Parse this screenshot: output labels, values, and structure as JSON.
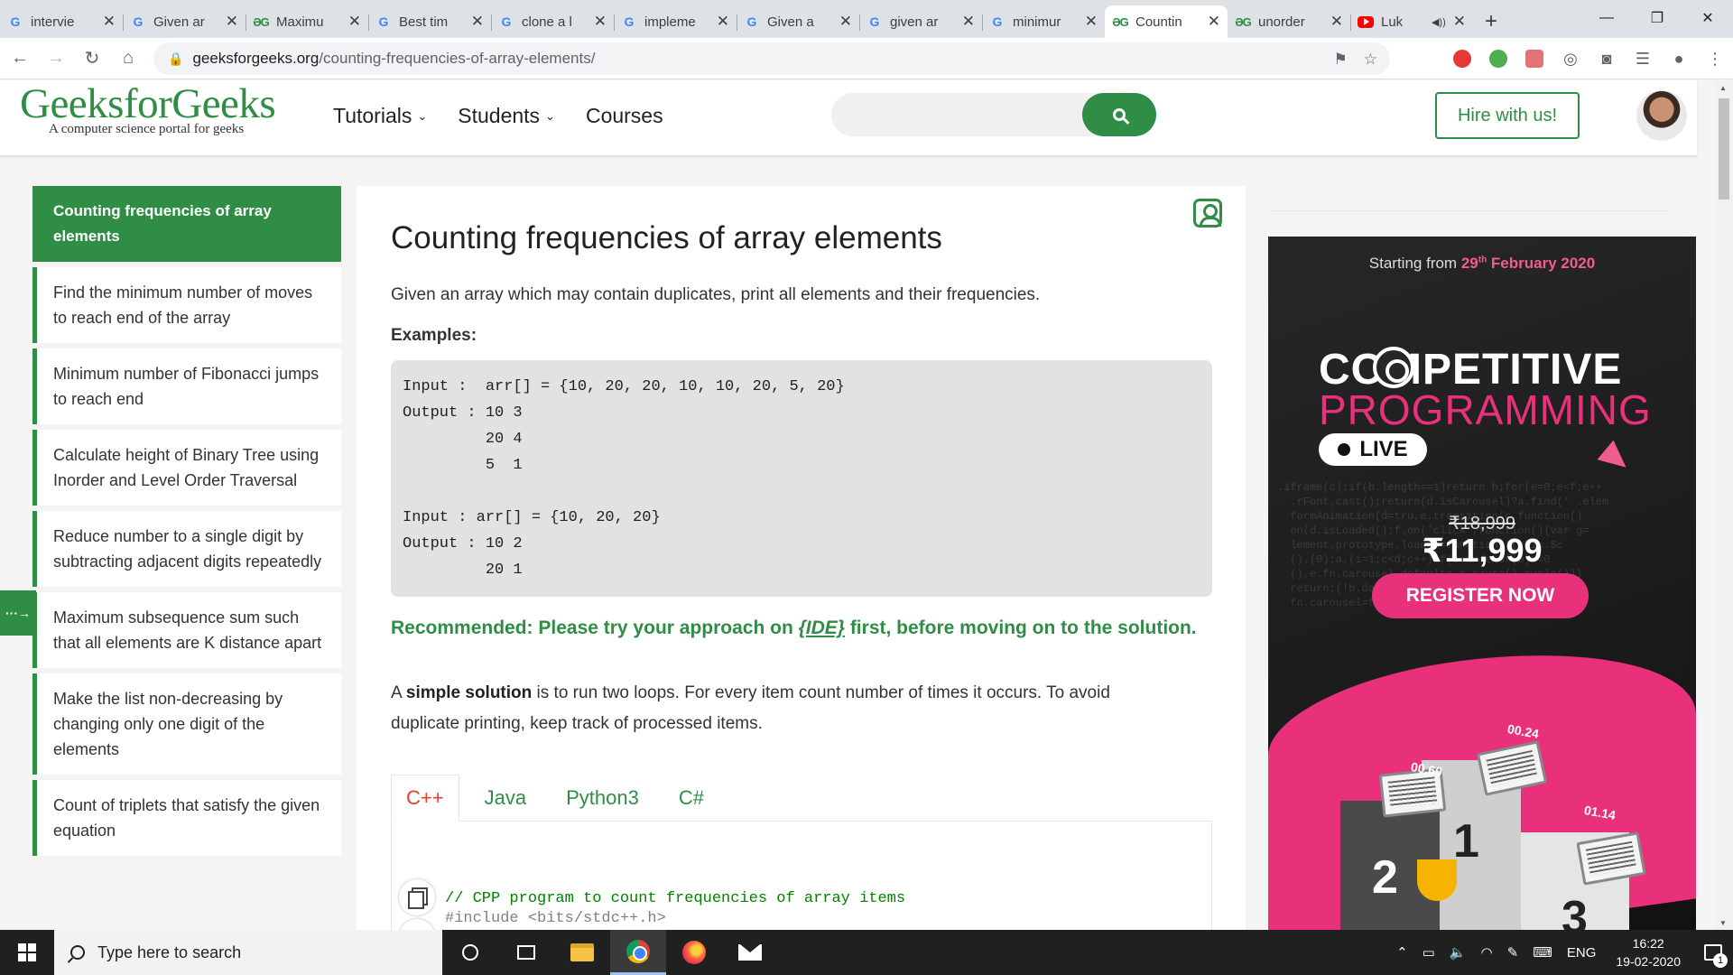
{
  "browser": {
    "tabs": [
      {
        "label": "intervie",
        "favicon": "google-icon"
      },
      {
        "label": "Given ar",
        "favicon": "google-icon"
      },
      {
        "label": "Maximu",
        "favicon": "gfg-icon"
      },
      {
        "label": "Best tim",
        "favicon": "google-icon"
      },
      {
        "label": "clone a l",
        "favicon": "google-icon"
      },
      {
        "label": "impleme",
        "favicon": "google-icon"
      },
      {
        "label": "Given a",
        "favicon": "google-icon"
      },
      {
        "label": "given ar",
        "favicon": "google-icon"
      },
      {
        "label": "minimur",
        "favicon": "google-icon"
      },
      {
        "label": "Countin",
        "favicon": "gfg-icon",
        "active": true
      },
      {
        "label": "unorder",
        "favicon": "gfg-icon"
      },
      {
        "label": "Luk",
        "favicon": "youtube-icon",
        "audio": true
      }
    ],
    "close_glyph": "✕",
    "url_domain": "geeksforgeeks.org",
    "url_path": "/counting-frequencies-of-array-elements/"
  },
  "site": {
    "logo": "GeeksforGeeks",
    "tagline": "A computer science portal for geeks",
    "nav": [
      "Tutorials",
      "Students",
      "Courses"
    ],
    "hire_label": "Hire with us!",
    "brand_color": "#2f8d46"
  },
  "sidebar": {
    "items": [
      "Counting frequencies of array elements",
      "Find the minimum number of moves to reach end of the array",
      "Minimum number of Fibonacci jumps to reach end",
      "Calculate height of Binary Tree using Inorder and Level Order Traversal",
      "Reduce number to a single digit by subtracting adjacent digits repeatedly",
      "Maximum subsequence sum such that all elements are K distance apart",
      "Make the list non-decreasing by changing only one digit of the elements",
      "Count of triplets that satisfy the given equation"
    ],
    "toggle_glyph": "···→"
  },
  "article": {
    "title": "Counting frequencies of array elements",
    "intro": "Given an array which may contain duplicates, print all elements and their frequencies.",
    "examples_label": "Examples:",
    "example_code": "Input :  arr[] = {10, 20, 20, 10, 10, 20, 5, 20}\nOutput : 10 3\n         20 4\n         5  1\n\nInput : arr[] = {10, 20, 20}\nOutput : 10 2\n         20 1",
    "recommend_before": "Recommended: Please try your approach on ",
    "recommend_link": "{IDE}",
    "recommend_after": " first, before moving on to the solution.",
    "solution_a": "A ",
    "solution_bold": "simple solution",
    "solution_rest_1": " is to run two loops. For every item count number of times it occurs. To avoid",
    "solution_rest_2": "duplicate printing, keep track of processed items.",
    "lang_tabs": [
      "C++",
      "Java",
      "Python3",
      "C#"
    ],
    "active_tab": "C++",
    "code_line_1": "// CPP program to count frequencies of array items",
    "code_line_2": "#include <bits/stdc++.h>"
  },
  "ad": {
    "starting_prefix": "Starting from ",
    "starting_day": "29",
    "starting_sup": "th",
    "starting_month": " February 2020",
    "title_line1": "COMPETITIVE",
    "title_line2": "PROGRAMMING",
    "live_label": "LIVE",
    "old_price": "₹18,999",
    "new_price": "₹11,999",
    "register_label": "REGISTER NOW",
    "timers": [
      "00.24",
      "00.60",
      "01.14"
    ],
    "podium": [
      "2",
      "1",
      "3"
    ],
    "accent_color": "#e8317a"
  },
  "taskbar": {
    "search_placeholder": "Type here to search",
    "language": "ENG",
    "time": "16:22",
    "date": "19-02-2020",
    "notification_count": "1"
  }
}
